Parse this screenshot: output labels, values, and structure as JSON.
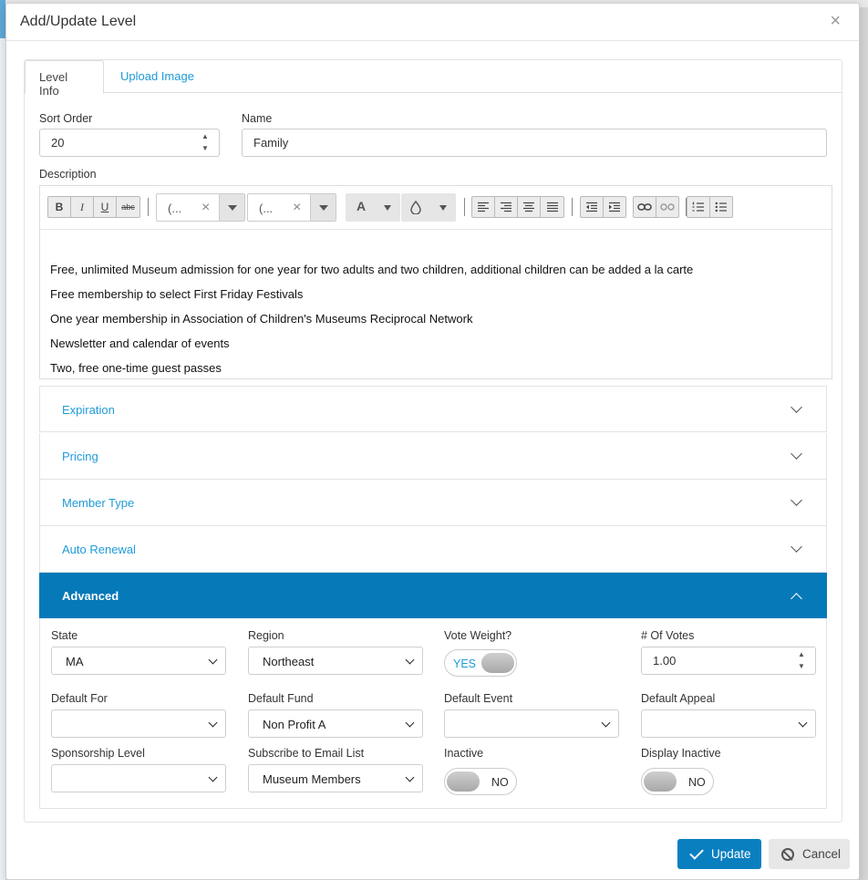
{
  "modal": {
    "title": "Add/Update Level",
    "close_glyph": "×"
  },
  "tabs": [
    {
      "label": "Level Info"
    },
    {
      "label": "Upload Image"
    }
  ],
  "form": {
    "sort_order": {
      "label": "Sort Order",
      "value": "20"
    },
    "name": {
      "label": "Name",
      "value": "Family"
    },
    "description": {
      "label": "Description"
    }
  },
  "editor": {
    "toolbar": {
      "bold": "B",
      "italic": "I",
      "underline": "U",
      "strike": "abc",
      "font_family": "(...",
      "font_size": "(...",
      "font_color": "A",
      "clear_glyph": "×"
    },
    "lines": [
      "Free, unlimited Museum admission for one year for two adults and two children, additional children can be added a la carte",
      "Free membership to select First Friday Festivals",
      "One year membership in Association of Children's Museums Reciprocal Network",
      "Newsletter and calendar of events",
      "Two, free one-time guest passes"
    ]
  },
  "accordion": [
    {
      "title": "Expiration",
      "expanded": false
    },
    {
      "title": "Pricing",
      "expanded": false
    },
    {
      "title": "Member Type",
      "expanded": false
    },
    {
      "title": "Auto Renewal",
      "expanded": false
    },
    {
      "title": "Advanced",
      "expanded": true
    }
  ],
  "advanced": {
    "state": {
      "label": "State",
      "value": "MA"
    },
    "region": {
      "label": "Region",
      "value": "Northeast"
    },
    "vote_weight": {
      "label": "Vote Weight?",
      "value": "YES"
    },
    "num_votes": {
      "label": "# Of Votes",
      "value": "1.00"
    },
    "default_for": {
      "label": "Default For",
      "value": ""
    },
    "default_fund": {
      "label": "Default Fund",
      "value": "Non Profit A"
    },
    "default_event": {
      "label": "Default Event",
      "value": ""
    },
    "default_appeal": {
      "label": "Default Appeal",
      "value": ""
    },
    "sponsorship_level": {
      "label": "Sponsorship Level",
      "value": ""
    },
    "email_list": {
      "label": "Subscribe to Email List",
      "value": "Museum Members"
    },
    "inactive": {
      "label": "Inactive",
      "value": "NO"
    },
    "display_inactive": {
      "label": "Display Inactive",
      "value": "NO"
    }
  },
  "buttons": {
    "update": "Update",
    "cancel": "Cancel"
  }
}
